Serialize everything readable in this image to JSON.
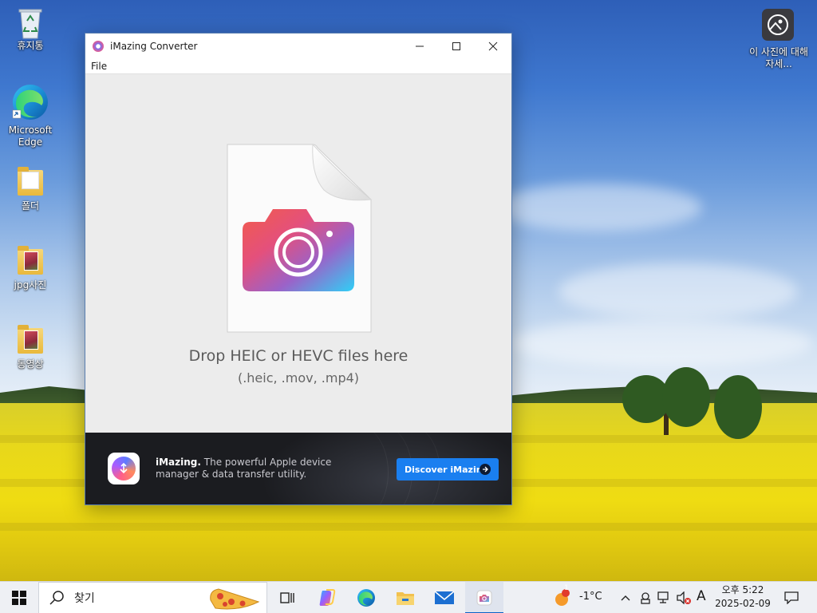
{
  "desktop": {
    "icons": [
      {
        "label": "휴지통"
      },
      {
        "label": "Microsoft Edge"
      },
      {
        "label": "폴더"
      },
      {
        "label": "jpg사진"
      },
      {
        "label": "동영상"
      }
    ],
    "about_photo_label": "이 사진에 대해 자세..."
  },
  "window": {
    "title": "iMazing Converter",
    "menu": [
      "File"
    ],
    "drop_title": "Drop HEIC or HEVC files here",
    "drop_subtitle": "(.heic, .mov, .mp4)",
    "banner": {
      "brand": "iMazing.",
      "tagline": "The powerful Apple device manager & data transfer utility.",
      "button_label": "Discover iMazing"
    }
  },
  "taskbar": {
    "search_placeholder": "찾기",
    "weather": "-1°C",
    "weather_badge": "1",
    "ime": "A",
    "time": "오후 5:22",
    "date": "2025-02-09"
  },
  "colors": {
    "accent": "#1a7ff0",
    "banner_bg": "#1b1c20",
    "taskbar_active": "#0a64c8"
  }
}
